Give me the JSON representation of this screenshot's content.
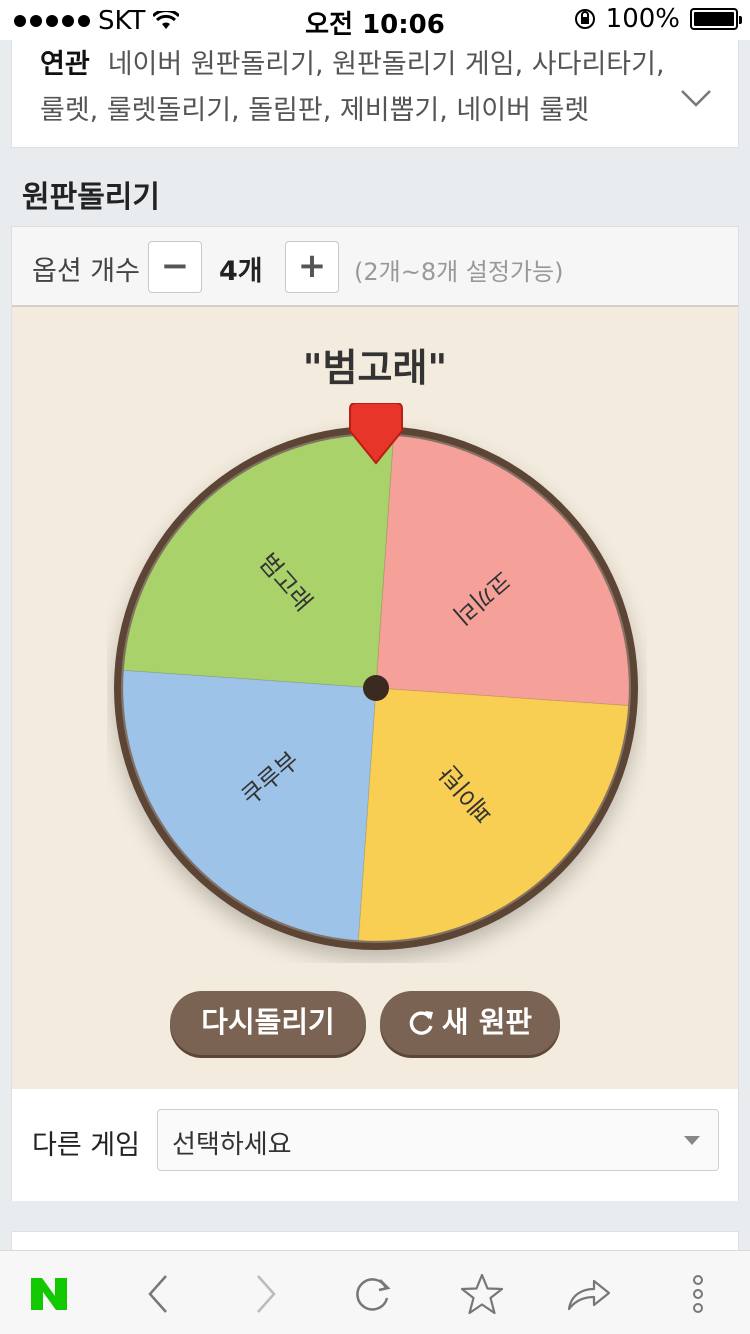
{
  "status_bar": {
    "carrier": "SKT",
    "time": "오전 10:06",
    "battery": "100%"
  },
  "related": {
    "label": "연관",
    "links": "네이버 원판돌리기, 원판돌리기 게임, 사다리타기,",
    "links2": "룰렛, 룰렛돌리기, 돌림판, 제비뽑기, 네이버 룰렛"
  },
  "section_title": "원판돌리기",
  "options": {
    "label": "옵션 개수",
    "minus": "−",
    "count": "4개",
    "plus": "+",
    "hint": "(2개~8개 설정가능)"
  },
  "wheel": {
    "result": "\"범고래\"",
    "segments": [
      {
        "label": "범고래",
        "color": "#a9d26a"
      },
      {
        "label": "코끼리",
        "color": "#f5a199"
      },
      {
        "label": "페이탄",
        "color": "#f8cf52"
      },
      {
        "label": "쿠루부",
        "color": "#9ec3e8"
      }
    ],
    "pointer_color": "#e8352a",
    "rim_color": "#5b4435"
  },
  "buttons": {
    "spin": "다시돌리기",
    "new": "새 원판"
  },
  "other_game": {
    "label": "다른 게임",
    "select_value": "선택하세요"
  },
  "toolbar": {
    "logo": "N"
  }
}
